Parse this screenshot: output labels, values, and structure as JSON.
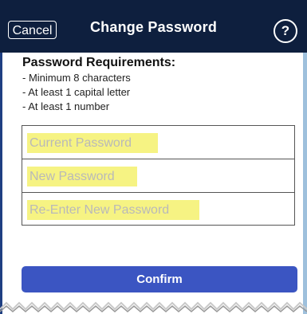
{
  "header": {
    "cancel_label": "Cancel",
    "title": "Change Password",
    "help_label": "?"
  },
  "requirements": {
    "title": "Password Requirements:",
    "items": [
      "- Minimum 8 characters",
      "- At least 1 capital letter",
      "- At least 1 number"
    ]
  },
  "fields": {
    "current_password_placeholder": "Current Password",
    "new_password_placeholder": "New Password",
    "reenter_password_placeholder": "Re-Enter New Password"
  },
  "actions": {
    "confirm_label": "Confirm"
  },
  "colors": {
    "nav_background": "#0e1f3e",
    "confirm_button": "#3b55c2",
    "field_highlight": "#f6f383",
    "placeholder_text": "#b9b9b9",
    "right_edge": "#9ec0dc"
  }
}
